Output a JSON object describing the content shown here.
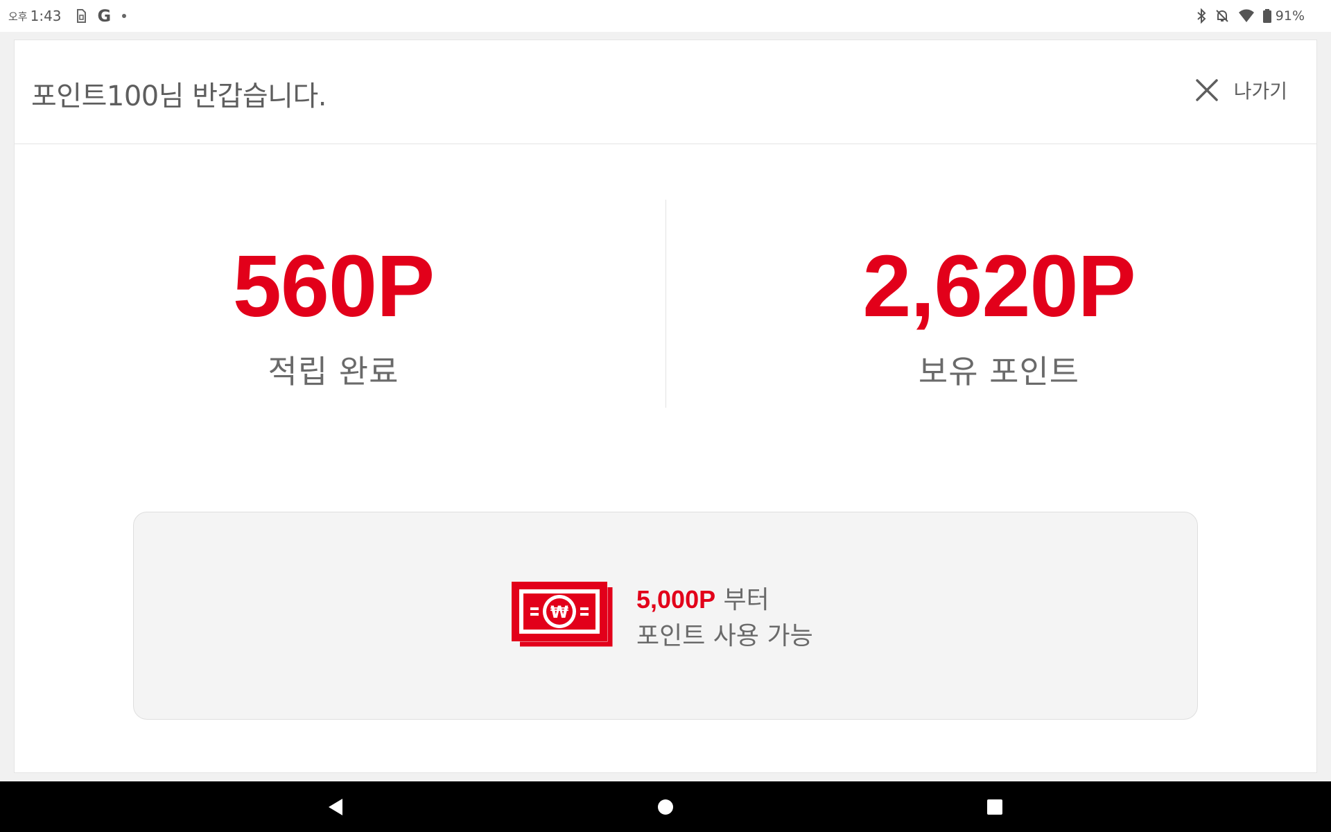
{
  "status_bar": {
    "ampm": "오후",
    "time": "1:43",
    "battery": "91%",
    "icons_left": [
      "sim-icon",
      "google-icon",
      "notification-dot-icon"
    ],
    "icons_right": [
      "bluetooth-icon",
      "notifications-off-icon",
      "wifi-icon",
      "battery-icon"
    ]
  },
  "header": {
    "greeting": "포인트100님 반갑습니다.",
    "exit_label": "나가기"
  },
  "stats": {
    "earned": {
      "value": "560P",
      "label": "적립 완료"
    },
    "balance": {
      "value": "2,620P",
      "label": "보유 포인트"
    }
  },
  "info": {
    "amount": "5,000P",
    "suffix": " 부터",
    "line2": "포인트 사용 가능"
  },
  "colors": {
    "accent": "#e2001a",
    "text": "#5e5e5e",
    "box_bg": "#f4f4f4"
  }
}
